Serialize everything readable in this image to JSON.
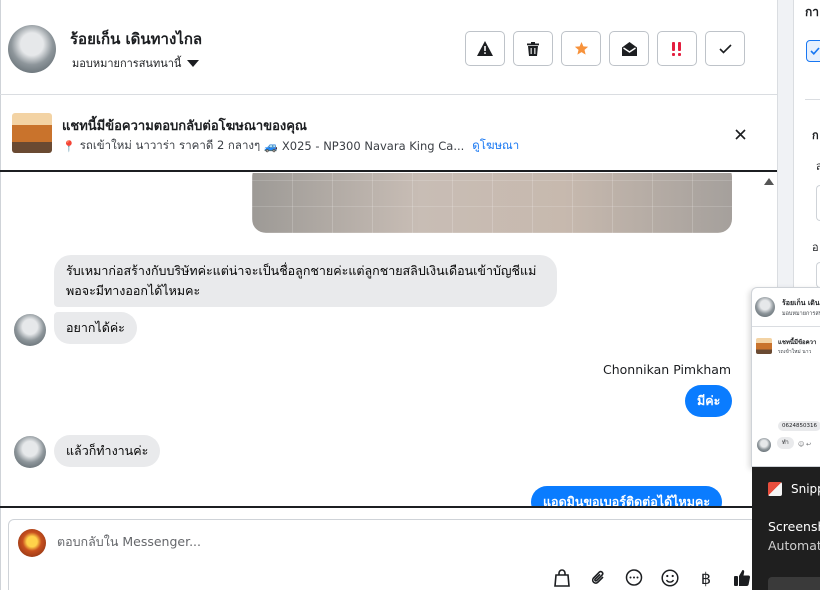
{
  "header": {
    "contact_name": "ร้อยเก็น เดินทางไกล",
    "assign_label": "มอบหมายการสนทนานี้",
    "actions": [
      {
        "name": "report-button",
        "icon": "warning-icon"
      },
      {
        "name": "delete-button",
        "icon": "trash-icon"
      },
      {
        "name": "star-button",
        "icon": "star-icon"
      },
      {
        "name": "mark-unread-button",
        "icon": "envelope-open-icon"
      },
      {
        "name": "flag-button",
        "icon": "alert-icon"
      },
      {
        "name": "mark-done-button",
        "icon": "check-icon"
      }
    ]
  },
  "banner": {
    "title": "แชทนี้มีข้อความตอบกลับต่อโฆษณาของคุณ",
    "subtitle": "รถเข้าใหม่ นาวาร่า ราคาดี 2 กลางๆ",
    "subtitle2": "X025 - NP300 Navara King Ca...",
    "view_ad": "ดูโฆษณา"
  },
  "messages": {
    "in1": "รับเหมาก่อสร้างกับบริษัทค่ะแต่น่าจะเป็นชื่อลูกชายค่ะแต่ลูกชายสลิปเงินเดือนเข้าบัญชีแม่พอจะมีทางออกได้ไหมคะ",
    "in2": "อยากได้ค่ะ",
    "sender_name": "Chonnikan Pimkham",
    "out1": "มีค่ะ",
    "in3": "แล้วก็ทำงานค่ะ",
    "out2": "แอดมินขอเบอร์ติดต่อได้ไหมคะ"
  },
  "composer": {
    "placeholder": "ตอบกลับใน Messenger..."
  },
  "right_panel": {
    "heading": "กา",
    "label1": "ก",
    "label2": "ส",
    "label3": "อ"
  },
  "thumbnail": {
    "name": "ร้อยเก็น เดิน",
    "assign": "มอบหมายการสน",
    "banner": "แชทนี้มีข้อควา",
    "banner2": "รถเข้าใหม่ นาว",
    "bubble": "0624850316",
    "bubble2": "ทำ"
  },
  "notification": {
    "app": "Snipp",
    "title": "Screensh",
    "subtitle": "Automat"
  },
  "colors": {
    "accent": "#0a7cff",
    "link": "#1877f2",
    "star": "#f7923b",
    "alert": "#e41e3f"
  }
}
